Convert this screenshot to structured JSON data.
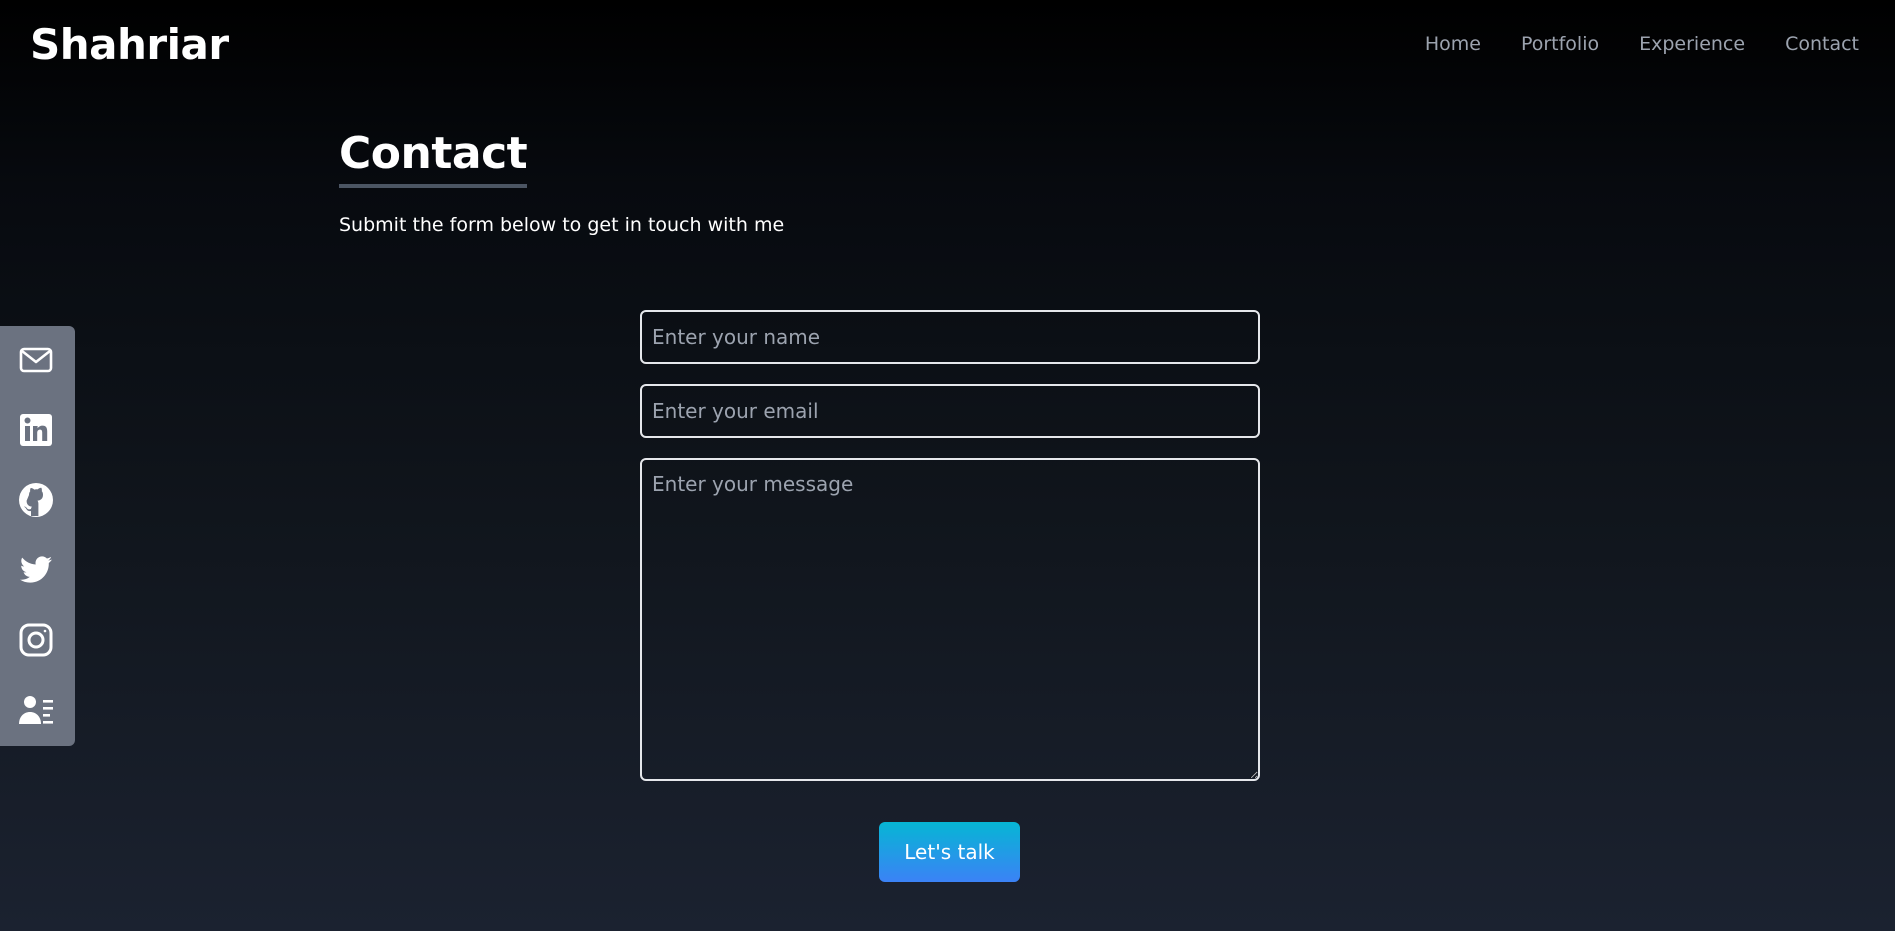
{
  "brand": "Shahriar",
  "nav": {
    "items": [
      {
        "label": "Home"
      },
      {
        "label": "Portfolio"
      },
      {
        "label": "Experience"
      },
      {
        "label": "Contact"
      }
    ]
  },
  "social": {
    "icons": [
      "mail-icon",
      "linkedin-icon",
      "github-icon",
      "twitter-icon",
      "instagram-icon",
      "resume-icon"
    ],
    "bar_color": "#6b7280"
  },
  "contact": {
    "title": "Contact",
    "subtitle": "Submit the form below to get in touch with me"
  },
  "form": {
    "name_placeholder": "Enter your name",
    "email_placeholder": "Enter your email",
    "message_placeholder": "Enter your message",
    "submit_label": "Let's talk"
  },
  "colors": {
    "accent_start": "#06b6d4",
    "accent_end": "#3b82f6",
    "nav_text": "#9ca3af"
  }
}
